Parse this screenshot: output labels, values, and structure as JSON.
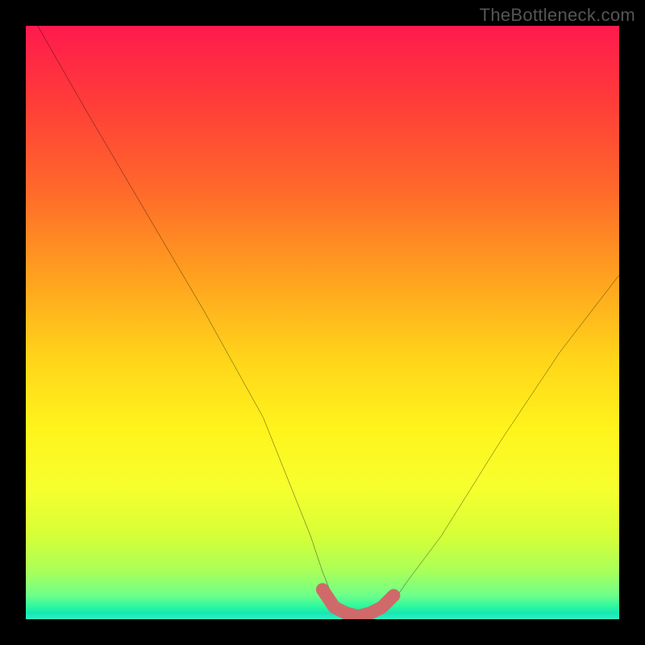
{
  "watermark": "TheBottleneck.com",
  "chart_data": {
    "type": "line",
    "title": "",
    "xlabel": "",
    "ylabel": "",
    "xlim": [
      0,
      100
    ],
    "ylim": [
      0,
      100
    ],
    "series": [
      {
        "name": "curve",
        "x": [
          2,
          10,
          20,
          30,
          40,
          48,
          50,
          52,
          54,
          56,
          58,
          60,
          62,
          64,
          70,
          80,
          90,
          100
        ],
        "y": [
          100,
          86,
          69,
          52,
          34,
          14,
          8,
          3,
          1,
          0.5,
          0.5,
          1,
          3,
          6,
          14,
          30,
          45,
          58
        ]
      }
    ],
    "highlight_segment": {
      "name": "bottom-highlight",
      "color": "#d06a6a",
      "x": [
        50,
        52,
        54,
        56,
        58,
        60,
        62
      ],
      "y": [
        5,
        2,
        1,
        0.5,
        1,
        2,
        4
      ]
    }
  }
}
